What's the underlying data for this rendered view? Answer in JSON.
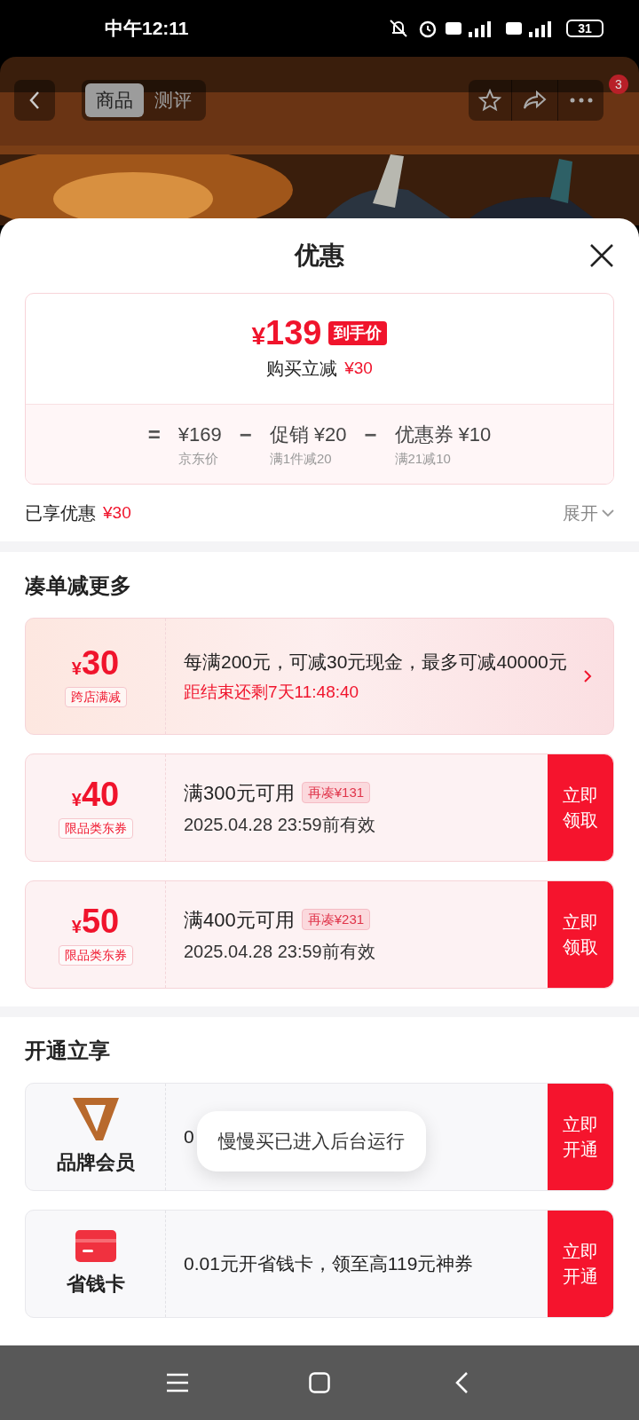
{
  "status_bar": {
    "time": "中午12:11",
    "battery": "31"
  },
  "header": {
    "tabs": [
      {
        "label": "商品",
        "selected": true
      },
      {
        "label": "测评",
        "selected": false
      }
    ],
    "more_badge": "3"
  },
  "sheet": {
    "title": "优惠",
    "summary": {
      "price_symbol": "¥",
      "price": "139",
      "price_tag": "到手价",
      "instant_label": "购买立减",
      "instant_amount": "¥30",
      "breakdown": [
        {
          "kind": "equals",
          "symbol": "="
        },
        {
          "kind": "term",
          "value": "¥169",
          "note": "京东价"
        },
        {
          "kind": "minus",
          "symbol": "−"
        },
        {
          "kind": "term",
          "value": "促销 ¥20",
          "note": "满1件减20"
        },
        {
          "kind": "minus",
          "symbol": "−"
        },
        {
          "kind": "term",
          "value": "优惠券 ¥10",
          "note": "满21减10"
        }
      ]
    },
    "enjoyed": {
      "label": "已享优惠",
      "amount": "¥30",
      "expand": "展开"
    },
    "sections": [
      {
        "title": "凑单减更多",
        "items": [
          {
            "kind": "promo",
            "symbol": "¥",
            "amount": "30",
            "tag": "跨店满减",
            "text": "每满200元，可减30元现金，最多可减40000元",
            "countdown": "距结束还剩7天11:48:40"
          },
          {
            "kind": "coupon",
            "symbol": "¥",
            "amount": "40",
            "tag": "限品类东券",
            "text": "满300元可用",
            "hint": "再凑¥131",
            "validity": "2025.04.28 23:59前有效",
            "button": "立即领取"
          },
          {
            "kind": "coupon",
            "symbol": "¥",
            "amount": "50",
            "tag": "限品类东券",
            "text": "满400元可用",
            "hint": "再凑¥231",
            "validity": "2025.04.28 23:59前有效",
            "button": "立即领取"
          }
        ]
      },
      {
        "title": "开通立享",
        "items": [
          {
            "kind": "brand",
            "name": "品牌会员",
            "text": "0",
            "button": "立即开通"
          },
          {
            "kind": "card",
            "name": "省钱卡",
            "text": "0.01元开省钱卡，领至高119元神券",
            "button": "立即开通"
          }
        ]
      }
    ]
  },
  "toast": "慢慢买已进入后台运行"
}
